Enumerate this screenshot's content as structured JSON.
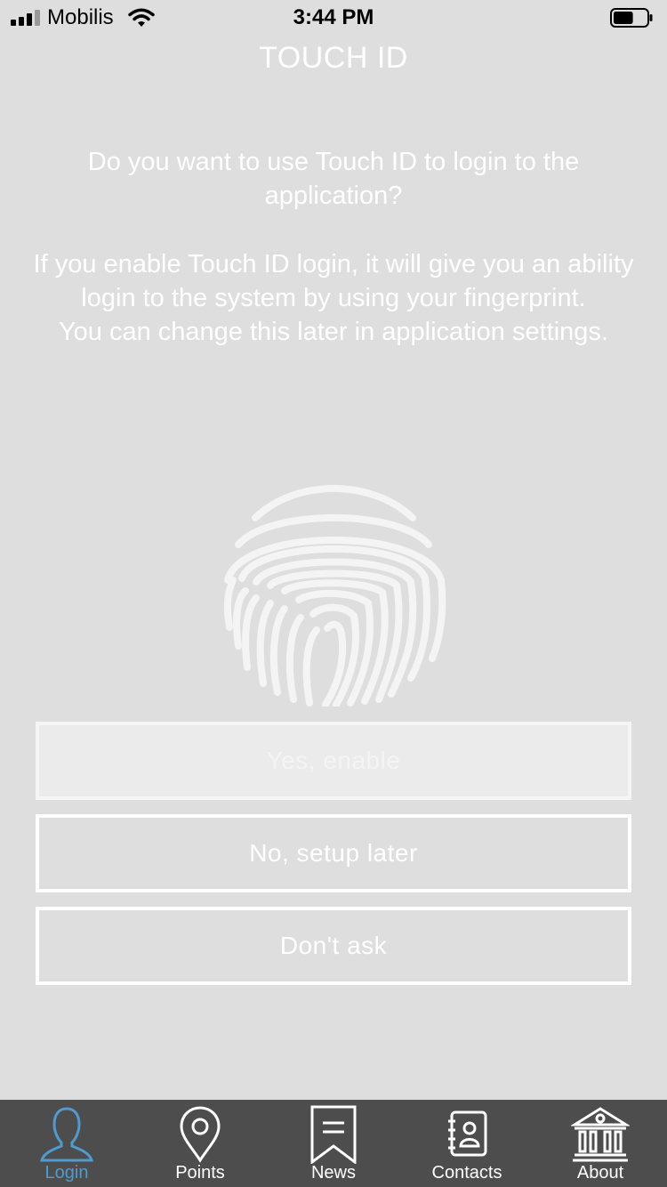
{
  "status_bar": {
    "carrier": "Mobilis",
    "time": "3:44 PM",
    "battery_level": 0.6
  },
  "header": {
    "title": "TOUCH ID"
  },
  "content": {
    "prompt": "Do you want to use Touch ID to login to the application?",
    "info": "If you enable Touch ID login, it will give you an ability login to the system by using your fingerprint.\nYou can change this later in application settings."
  },
  "actions": {
    "enable_label": "Yes, enable",
    "later_label": "No, setup later",
    "never_label": "Don't ask"
  },
  "tab_bar": {
    "active": "Login",
    "active_color": "#4e9bd0",
    "items": [
      {
        "label": "Login",
        "icon": "user-icon"
      },
      {
        "label": "Points",
        "icon": "map-pin-icon"
      },
      {
        "label": "News",
        "icon": "bookmark-icon"
      },
      {
        "label": "Contacts",
        "icon": "contacts-book-icon"
      },
      {
        "label": "About",
        "icon": "bank-building-icon"
      }
    ]
  }
}
